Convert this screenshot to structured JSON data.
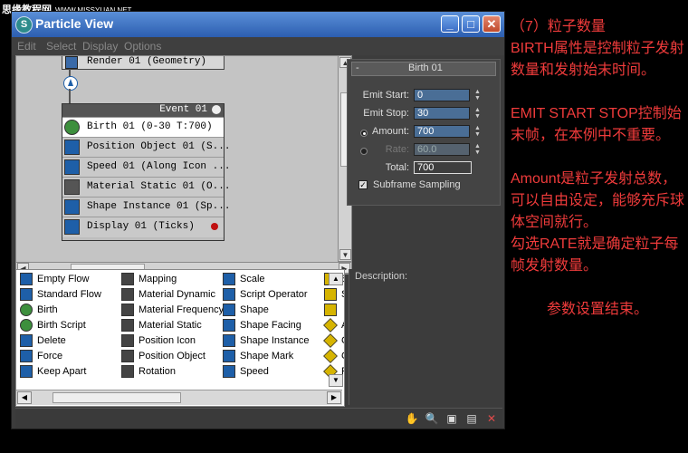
{
  "watermark": {
    "text": "思缘教程网",
    "sub": "WWW.MISSYUAN.NET"
  },
  "window": {
    "title": "Particle View",
    "min": "_",
    "max": "□",
    "close": "✕"
  },
  "menu": [
    "Edit",
    "Select",
    "Display",
    "Options"
  ],
  "graph": {
    "render_op": "Render 01 (Geometry)",
    "event_title": "Event 01",
    "operators": [
      {
        "label": "Birth 01 (0-30 T:700)",
        "icon": "birth-icon",
        "color": "#3d8f3d"
      },
      {
        "label": "Position Object 01 (S...",
        "icon": "position-object-icon",
        "color": "#1e5fa8"
      },
      {
        "label": "Speed 01 (Along Icon ...",
        "icon": "speed-icon",
        "color": "#1e5fa8"
      },
      {
        "label": "Material Static 01 (O...",
        "icon": "material-static-icon",
        "color": "#555555"
      },
      {
        "label": "Shape Instance 01 (Sp...",
        "icon": "shape-instance-icon",
        "color": "#1e5fa8"
      },
      {
        "label": "Display 01 (Ticks)",
        "icon": "display-icon",
        "color": "#1e5fa8"
      }
    ]
  },
  "params": {
    "rollout_toggle": "-",
    "rollout_title": "Birth 01",
    "emit_start_label": "Emit Start:",
    "emit_start_value": "0",
    "emit_stop_label": "Emit Stop:",
    "emit_stop_value": "30",
    "amount_label": "Amount:",
    "amount_value": "700",
    "rate_label": "Rate:",
    "rate_value": "60.0",
    "total_label": "Total:",
    "total_value": "700",
    "subframe_label": "Subframe Sampling"
  },
  "depot": {
    "columns": [
      [
        "Empty Flow",
        "Standard Flow",
        "Birth",
        "Birth Script",
        "Delete",
        "Force",
        "Keep Apart"
      ],
      [
        "Mapping",
        "Material Dynamic",
        "Material Frequency",
        "Material Static",
        "Position Icon",
        "Position Object",
        "Rotation"
      ],
      [
        "Scale",
        "Script Operator",
        "Shape",
        "Shape Facing",
        "Shape Instance",
        "Shape Mark",
        "Speed"
      ],
      [
        "S",
        "S",
        "",
        "A",
        "C",
        "C",
        "F"
      ]
    ]
  },
  "description_label": "Description:",
  "annotation": {
    "line1": "（7）粒子数量",
    "line2": "BIRTH属性是控制粒子发射数量和发射始末时间。",
    "line3": "EMIT START STOP控制始末帧，在本例中不重要。",
    "line4": "Amount是粒子发射总数，可以自由设定，能够充斥球体空间就行。",
    "line5": "勾选RATE就是确定粒子每帧发射数量。",
    "line6": "参数设置结束。"
  }
}
